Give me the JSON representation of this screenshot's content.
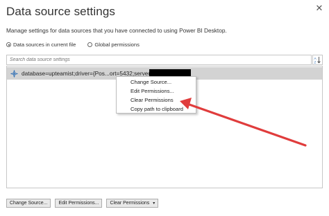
{
  "dialog": {
    "title": "Data source settings",
    "close_glyph": "✕",
    "subtitle": "Manage settings for data sources that you have connected to using Power BI Desktop."
  },
  "scope": {
    "options": [
      {
        "label": "Data sources in current file",
        "selected": true
      },
      {
        "label": "Global permissions",
        "selected": false
      }
    ]
  },
  "search": {
    "placeholder": "Search data source settings",
    "sort_icon": "sort-az-icon"
  },
  "data_sources": [
    {
      "text": "database=upteamist;driver={Pos...ort=5432;server=",
      "icon": "datasource-icon",
      "selected": true
    }
  ],
  "context_menu": {
    "items": [
      "Change Source...",
      "Edit Permissions...",
      "Clear Permissions",
      "Copy path to clipboard"
    ]
  },
  "buttons": {
    "change_source": "Change Source...",
    "edit_permissions": "Edit Permissions...",
    "clear_permissions": "Clear Permissions",
    "caret": "▾"
  },
  "colors": {
    "selection": "#d3d3d3",
    "annotation_arrow": "#e03c3c",
    "icon_accent": "#2f6fb5"
  }
}
